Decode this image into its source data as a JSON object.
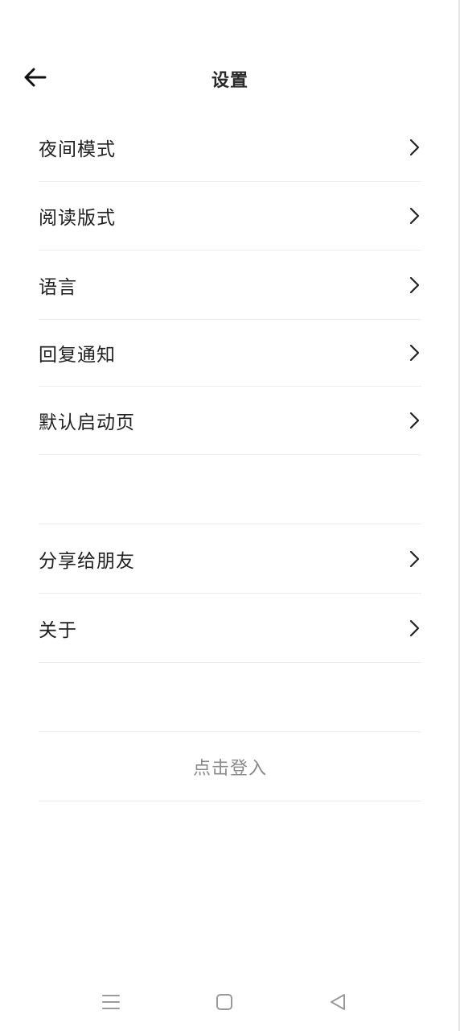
{
  "header": {
    "title": "设置"
  },
  "group1": {
    "items": [
      {
        "label": "夜间模式"
      },
      {
        "label": "阅读版式"
      },
      {
        "label": "语言"
      },
      {
        "label": "回复通知"
      },
      {
        "label": "默认启动页"
      }
    ]
  },
  "group2": {
    "items": [
      {
        "label": "分享给朋友"
      },
      {
        "label": "关于"
      }
    ]
  },
  "login": {
    "label": "点击登入"
  },
  "icons": {
    "back": "arrow-left-icon",
    "chevron": "chevron-right-icon",
    "nav_menu": "menu-icon",
    "nav_home": "square-home-icon",
    "nav_back": "triangle-back-icon"
  },
  "colors": {
    "text": "#1f1f1f",
    "muted": "#8a8a8a",
    "divider": "#ececec",
    "nav_icon": "#9a9a9a"
  }
}
